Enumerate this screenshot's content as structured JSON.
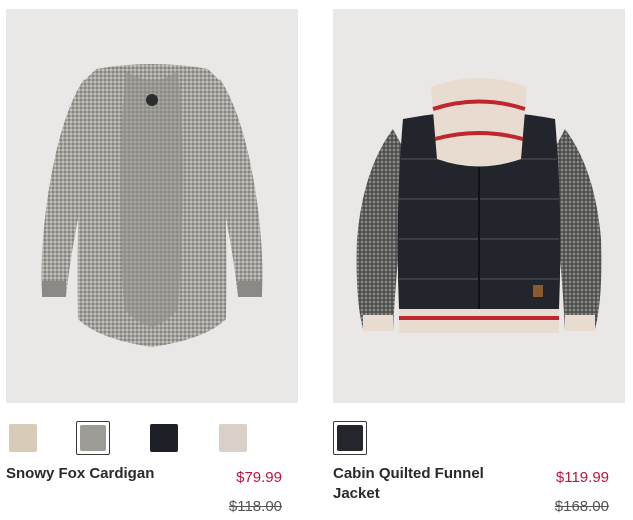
{
  "products": [
    {
      "name": "Snowy Fox Cardigan",
      "price": "$79.99",
      "original_price": "$118.00",
      "image_alt": "grey knit cardigan",
      "swatches": [
        {
          "label": "oatmeal",
          "color": "#d8cbb8"
        },
        {
          "label": "grey mix",
          "color": "#9c9b96",
          "selected": true
        },
        {
          "label": "black",
          "color": "#1d2026"
        },
        {
          "label": "cream heather",
          "color": "#d9d1c8"
        }
      ]
    },
    {
      "name": "Cabin Quilted Funnel Jacket",
      "price": "$119.99",
      "original_price": "$168.00",
      "image_alt": "quilted black jacket with knit sleeves",
      "swatches": [
        {
          "label": "black",
          "color": "#24262c",
          "selected": true
        }
      ]
    }
  ]
}
